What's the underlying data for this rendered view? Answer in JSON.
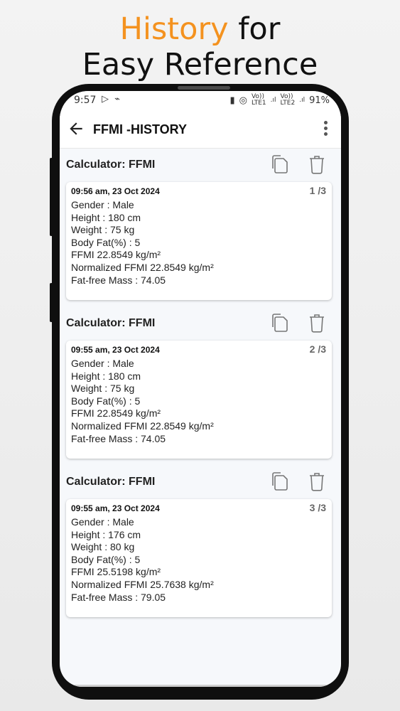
{
  "promo": {
    "accent": "History",
    "rest1": " for",
    "line2": "Easy Reference"
  },
  "status": {
    "time": "9:57",
    "left_icons": "▷ ⌁",
    "net1": "Vo))\nLTE1",
    "net2": "Vo))\nLTE2",
    "battery": "91%"
  },
  "appbar": {
    "title": "FFMI -HISTORY"
  },
  "entries": [
    {
      "calculator": "Calculator: FFMI",
      "date": "09:56 am, 23 Oct 2024",
      "count": "1 /3",
      "lines": [
        "Gender : Male",
        "Height : 180 cm",
        "Weight : 75 kg",
        "Body Fat(%) : 5",
        "FFMI 22.8549 kg/m²",
        "Normalized FFMI 22.8549 kg/m²",
        "Fat-free Mass : 74.05"
      ]
    },
    {
      "calculator": "Calculator: FFMI",
      "date": "09:55 am, 23 Oct 2024",
      "count": "2 /3",
      "lines": [
        "Gender : Male",
        "Height : 180 cm",
        "Weight : 75 kg",
        "Body Fat(%) : 5",
        "FFMI 22.8549 kg/m²",
        "Normalized FFMI 22.8549 kg/m²",
        "Fat-free Mass : 74.05"
      ]
    },
    {
      "calculator": "Calculator: FFMI",
      "date": "09:55 am, 23 Oct 2024",
      "count": "3 /3",
      "lines": [
        "Gender : Male",
        "Height : 176 cm",
        "Weight : 80 kg",
        "Body Fat(%) : 5",
        "FFMI 25.5198 kg/m²",
        "Normalized FFMI 25.7638 kg/m²",
        "Fat-free Mass : 79.05"
      ]
    }
  ],
  "colors": {
    "accent": "#f4921f",
    "phone": "#0f0f0f",
    "screen_bg": "#f6f8fb"
  }
}
